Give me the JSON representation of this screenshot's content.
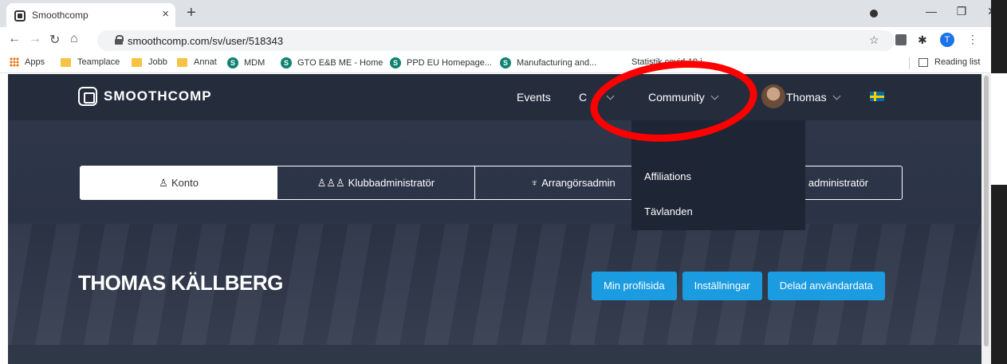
{
  "browser": {
    "tab_title": "Smoothcomp",
    "url": "smoothcomp.com/sv/user/518343",
    "profile_initial": "T",
    "bookmarks": [
      "Apps",
      "Teamplace",
      "Jobb",
      "Annat",
      "MDM",
      "GTO E&B ME - Home",
      "PPD EU Homepage...",
      "Manufacturing and...",
      "Statistik covid-19 i..."
    ],
    "reading_list": "Reading list"
  },
  "site": {
    "logo_text": "SMOOTHCOMP",
    "nav": {
      "events": "Events",
      "clubs": "C",
      "community": "Community",
      "user": "Thomas"
    },
    "dropdown_items": [
      "Affiliations",
      "Tävlanden"
    ],
    "tabs": [
      "Konto",
      "Klubbadministratör",
      "Arrangörsadmin",
      "administratör"
    ],
    "user_name": "THOMAS KÄLLBERG",
    "actions": [
      "Min profilsida",
      "Inställningar",
      "Delad användardata"
    ]
  },
  "colors": {
    "nav_bg": "#252d3d",
    "page_bg": "#2b3446",
    "button": "#1b9be0",
    "annotation": "#ff0000"
  }
}
